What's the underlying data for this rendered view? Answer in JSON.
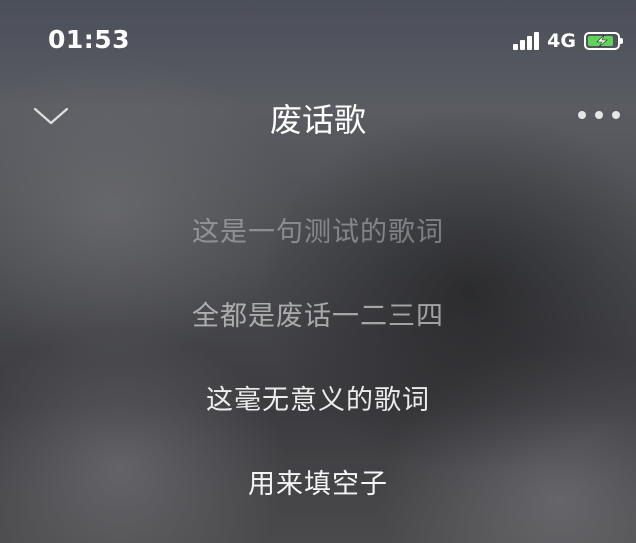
{
  "status": {
    "time": "01:53",
    "network": "4G",
    "battery_level": 0.9,
    "battery_color": "#5fd35a"
  },
  "player": {
    "title": "废话歌",
    "collapse_icon": "chevron-down-icon",
    "more_icon": "more-icon"
  },
  "lyrics": [
    {
      "text": "这是一句测试的歌词",
      "opacity": 0.35
    },
    {
      "text": "全都是废话一二三四",
      "opacity": 0.55
    },
    {
      "text": "这毫无意义的歌词",
      "opacity": 0.9
    },
    {
      "text": "用来填空子",
      "opacity": 0.95
    }
  ]
}
